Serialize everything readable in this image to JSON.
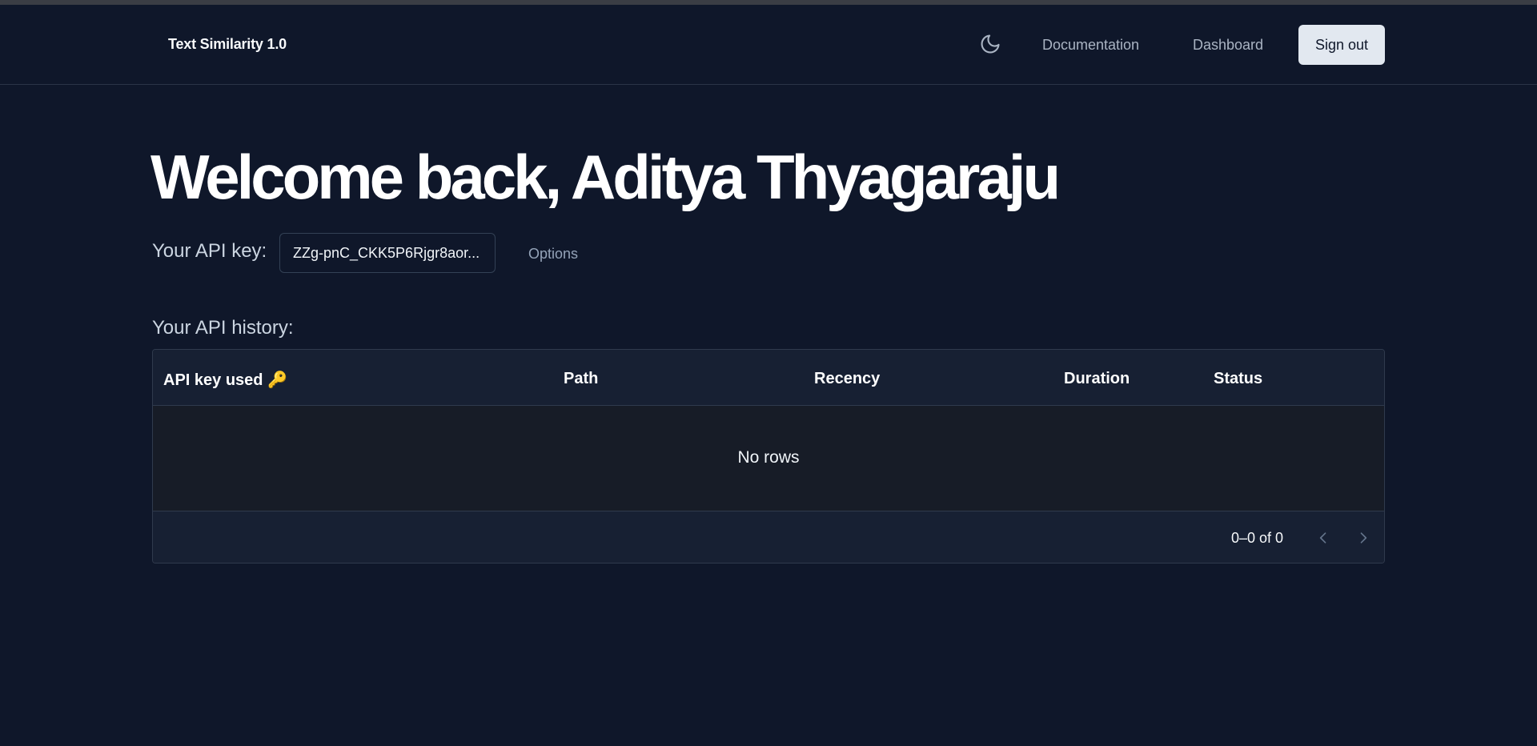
{
  "nav": {
    "brand": "Text Similarity 1.0",
    "theme_icon": "moon-icon",
    "links": [
      "Documentation",
      "Dashboard"
    ],
    "signout_label": "Sign out"
  },
  "main": {
    "welcome": "Welcome back, Aditya Thyagaraju",
    "api_key_label": "Your API key:",
    "api_key_value": "ZZg-pnC_CKK5P6Rjgr8aor...",
    "options_label": "Options",
    "history_label": "Your API history:"
  },
  "table": {
    "columns": [
      "API key used 🔑",
      "Path",
      "Recency",
      "Duration",
      "Status"
    ],
    "rows": [],
    "empty_text": "No rows",
    "pagination": "0–0 of 0"
  },
  "colors": {
    "background": "#0f172a",
    "header_bg": "#172033",
    "button_bg": "#e2e8f0"
  }
}
